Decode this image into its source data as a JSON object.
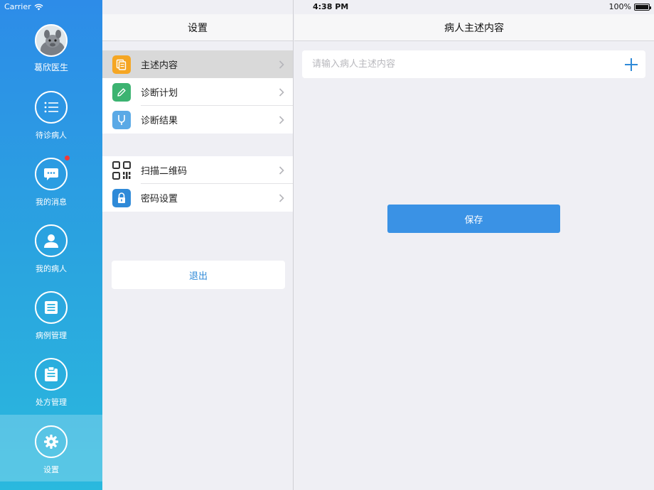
{
  "status_bar": {
    "carrier": "Carrier",
    "time": "4:38 PM",
    "battery": "100%",
    "icons": [
      "wifi-icon",
      "battery-icon"
    ]
  },
  "sidebar": {
    "profile_name": "葛欣医生",
    "items": [
      {
        "label": "待诊病人",
        "icon": "list-icon"
      },
      {
        "label": "我的消息",
        "icon": "message-icon",
        "has_badge": true
      },
      {
        "label": "我的病人",
        "icon": "person-icon"
      },
      {
        "label": "病例管理",
        "icon": "case-icon"
      },
      {
        "label": "处方管理",
        "icon": "clipboard-icon"
      },
      {
        "label": "设置",
        "icon": "gear-icon",
        "active": true
      }
    ],
    "colors": {
      "gradient_top": "#2d8ce8",
      "gradient_bottom": "#2ab9de",
      "badge": "#f03a3a"
    }
  },
  "settings": {
    "title": "设置",
    "group1": [
      {
        "label": "主述内容",
        "icon": "document-icon",
        "color": "#f5a623",
        "selected": true
      },
      {
        "label": "诊断计划",
        "icon": "pencil-icon",
        "color": "#3cb371"
      },
      {
        "label": "诊断结果",
        "icon": "stethoscope-icon",
        "color": "#5aa9e6"
      }
    ],
    "group2": [
      {
        "label": "扫描二维码",
        "icon": "qrcode-icon",
        "color": "#333333"
      },
      {
        "label": "密码设置",
        "icon": "lock-icon",
        "color": "#2f8ad8"
      }
    ],
    "logout_label": "退出"
  },
  "detail": {
    "title": "病人主述内容",
    "input_placeholder": "请输入病人主述内容",
    "input_value": "",
    "save_label": "保存",
    "accent": "#3a92e5"
  }
}
